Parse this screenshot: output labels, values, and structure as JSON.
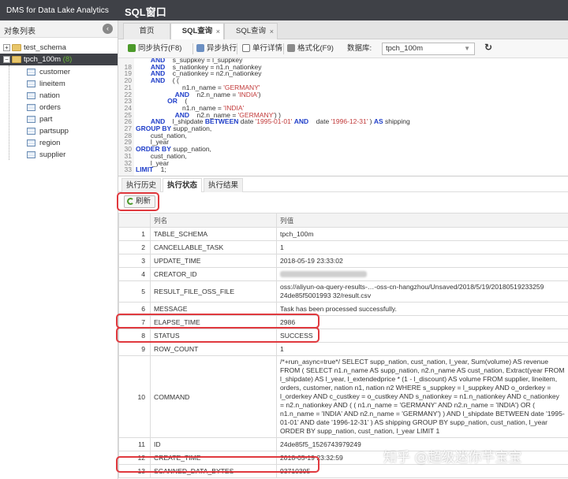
{
  "app": {
    "brand": "DMS for Data Lake Analytics",
    "window_title": "SQL窗口"
  },
  "sidebar": {
    "title": "对象列表",
    "databases": [
      {
        "name": "test_schema",
        "count": ""
      },
      {
        "name": "tpch_100m",
        "count": "(8)"
      }
    ],
    "tables": [
      "customer",
      "lineitem",
      "nation",
      "orders",
      "part",
      "partsupp",
      "region",
      "supplier"
    ]
  },
  "tabs": [
    {
      "label": "首页"
    },
    {
      "label": "SQL查询"
    },
    {
      "label": "SQL查询"
    }
  ],
  "toolbar": {
    "sync_exec": "同步执行(F8)",
    "async_exec": "异步执行",
    "single_row": "单行详情",
    "format": "格式化(F9)",
    "db_label": "数据库:",
    "db_value": "tpch_100m"
  },
  "editor": {
    "line_numbers": [
      "",
      "18",
      "19",
      "20",
      "21",
      "22",
      "23",
      "24",
      "25",
      "26",
      "27",
      "28",
      "29",
      "30",
      "31",
      "32",
      "33",
      "34"
    ],
    "lines": [
      "        AND    s_suppkey = l_suppkey",
      "        AND    s_nationkey = n1.n_nationkey",
      "        AND    c_nationkey = n2.n_nationkey",
      "        AND    ( (",
      "                         n1.n_name = 'GERMANY'",
      "                     AND    n2.n_name = 'INDIA')",
      "                 OR    (",
      "                         n1.n_name = 'INDIA'",
      "                     AND    n2.n_name = 'GERMANY') )",
      "        AND    l_shipdate BETWEEN date '1995-01-01' AND    date '1996-12-31' ) AS shipping",
      "GROUP BY supp_nation,",
      "        cust_nation,",
      "        l_year",
      "ORDER BY supp_nation,",
      "        cust_nation,",
      "        l_year",
      "LIMIT    1;"
    ]
  },
  "panel_tabs": [
    "执行历史",
    "执行状态",
    "执行结果"
  ],
  "refresh_label": "刷新",
  "result": {
    "columns": [
      "列名",
      "列值"
    ],
    "rows": [
      {
        "n": "1",
        "name": "TABLE_SCHEMA",
        "value": "tpch_100m"
      },
      {
        "n": "2",
        "name": "CANCELLABLE_TASK",
        "value": "1"
      },
      {
        "n": "3",
        "name": "UPDATE_TIME",
        "value": "2018-05-19 23:33:02"
      },
      {
        "n": "4",
        "name": "CREATOR_ID",
        "value": ""
      },
      {
        "n": "5",
        "name": "RESULT_FILE_OSS_FILE",
        "value": "oss://aliyun-oa-query-results-…-oss-cn-hangzhou/Unsaved/2018/5/19/20180519233259 24de85f5001993 32/result.csv"
      },
      {
        "n": "6",
        "name": "MESSAGE",
        "value": "Task has been processed successfully."
      },
      {
        "n": "7",
        "name": "ELAPSE_TIME",
        "value": "2986"
      },
      {
        "n": "8",
        "name": "STATUS",
        "value": "SUCCESS"
      },
      {
        "n": "9",
        "name": "ROW_COUNT",
        "value": "1"
      },
      {
        "n": "10",
        "name": "COMMAND",
        "value": "/*+run_async=true*/ SELECT supp_nation, cust_nation, l_year, Sum(volume) AS revenue FROM ( SELECT n1.n_name AS supp_nation, n2.n_name AS cust_nation, Extract(year FROM l_shipdate) AS l_year, l_extendedprice * (1 - l_discount) AS volume FROM supplier, lineitem, orders, customer, nation n1, nation n2 WHERE s_suppkey = l_suppkey AND o_orderkey = l_orderkey AND c_custkey = o_custkey AND s_nationkey = n1.n_nationkey AND c_nationkey = n2.n_nationkey AND ( ( n1.n_name = 'GERMANY' AND n2.n_name = 'INDIA') OR ( n1.n_name = 'INDIA' AND n2.n_name = 'GERMANY') ) AND l_shipdate BETWEEN date '1995-01-01' AND date '1996-12-31' ) AS shipping GROUP BY supp_nation, cust_nation, l_year ORDER BY supp_nation, cust_nation, l_year LIMIT 1"
      },
      {
        "n": "11",
        "name": "ID",
        "value": "24de85f5_1526743979249"
      },
      {
        "n": "12",
        "name": "CREATE_TIME",
        "value": "2018-05-19 23:32:59"
      },
      {
        "n": "13",
        "name": "SCANNED_DATA_BYTES",
        "value": "93710305"
      }
    ]
  },
  "watermark": "知乎 @超级迷你芊宝宝"
}
